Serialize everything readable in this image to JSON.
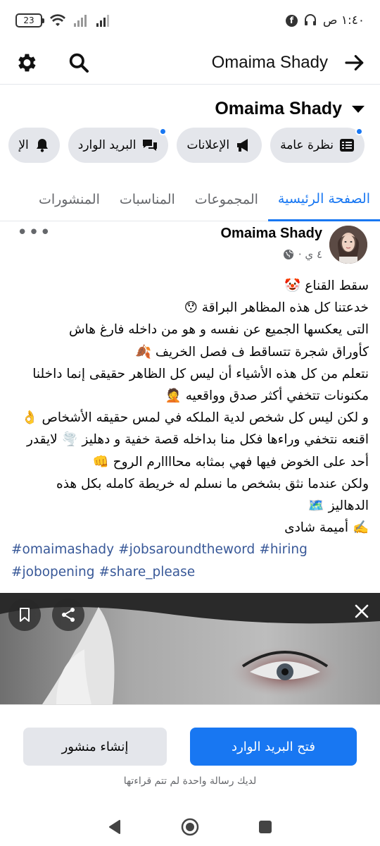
{
  "status_bar": {
    "time": "١:٤٠ ص",
    "battery": "23",
    "app_badge": "f",
    "network": "ixl"
  },
  "header": {
    "title": "Omaima Shady",
    "back_icon": "arrow-right-icon",
    "search_icon": "search-icon",
    "settings_icon": "gear-icon"
  },
  "profile": {
    "name": "Omaima Shady"
  },
  "chips": [
    {
      "label": "نظرة عامة",
      "icon": "list-icon",
      "has_dot": true
    },
    {
      "label": "الإعلانات",
      "icon": "megaphone-icon",
      "has_dot": false
    },
    {
      "label": "البريد الوارد",
      "icon": "chat-icon",
      "has_dot": true
    },
    {
      "label": "الإ",
      "icon": "bell-icon",
      "has_dot": false
    }
  ],
  "tabs": [
    {
      "label": "الصفحة الرئيسية",
      "active": true
    },
    {
      "label": "المجموعات",
      "active": false
    },
    {
      "label": "المناسبات",
      "active": false
    },
    {
      "label": "المنشورات",
      "active": false
    }
  ],
  "post": {
    "author": "Omaima Shady",
    "time": "٤ ي ·",
    "privacy_icon": "globe-icon",
    "lines": [
      "سقط القناع 🤡",
      "خدعتنا كل هذه المظاهر البراقة 😯",
      "التى يعكسها الجميع عن نفسه و هو من داخله فارغ هاش",
      "كأوراق شجرة تتساقط ف فصل الخريف 🍂",
      "نتعلم من كل هذه الأشياء أن ليس كل الظاهر حقيقى إنما داخلنا",
      "مكنونات تتخفي أكثر صدق وواقعيه 🤦",
      "و لكن ليس كل شخص لدية الملكه في لمس حقيقه الأشخاص 👌",
      "اقنعه نتخفي وراءها فكل منا بداخله قصة خفية و دهليز 🌪️ لايقدر",
      "أحد على الخوض فيها فهي بمثابه محاااارم الروح 👊",
      "ولكن عندما نثق بشخص ما نسلم له خريطة كامله بكل هذه",
      "الدهاليز 🗺️",
      "✍️ أميمة شادى"
    ],
    "hashtags_line1": [
      "#omaimashady",
      "#jobsaroundtheword",
      "#hiring"
    ],
    "hashtags_line2": [
      "#jobopening",
      "#share_please"
    ]
  },
  "image_controls": {
    "bookmark_icon": "bookmark-icon",
    "share_icon": "share-icon",
    "close_icon": "close-icon"
  },
  "bottom_sheet": {
    "create_post_label": "إنشاء منشور",
    "open_inbox_label": "فتح البريد الوارد",
    "unread_note": "لديك رسالة واحدة لم تتم قراءتها"
  },
  "colors": {
    "accent": "#1877f2",
    "chip_bg": "#e4e6eb",
    "muted_text": "#65676b",
    "hashtag": "#385898"
  }
}
